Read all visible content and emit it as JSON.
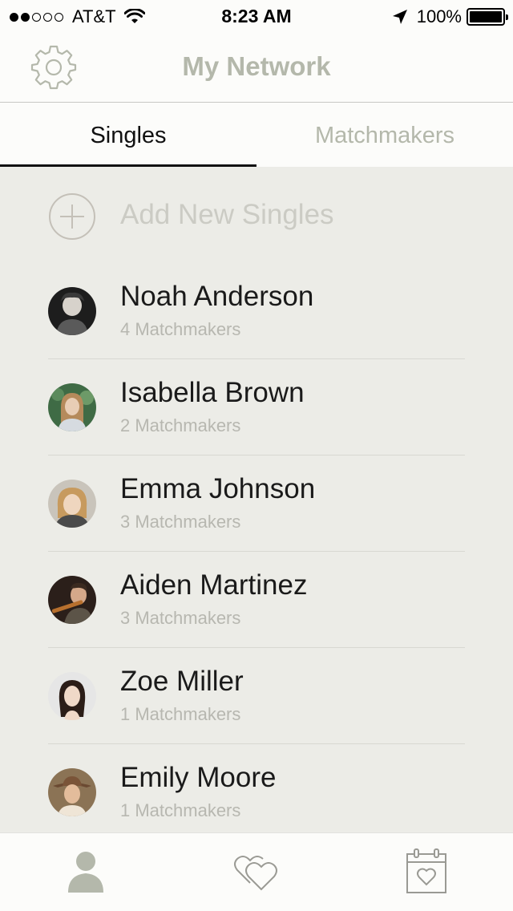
{
  "status_bar": {
    "carrier": "AT&T",
    "time": "8:23 AM",
    "battery": "100%",
    "signal_bars_filled": 2,
    "signal_bars_total": 5
  },
  "nav": {
    "title": "My Network",
    "settings_icon": "gear-icon"
  },
  "tabs": {
    "singles": "Singles",
    "matchmakers": "Matchmakers",
    "active": "singles"
  },
  "add_singles": {
    "label": "Add New Singles",
    "icon": "plus-circle-icon"
  },
  "people": [
    {
      "name": "Noah Anderson",
      "subtitle": "4 Matchmakers"
    },
    {
      "name": "Isabella Brown",
      "subtitle": "2 Matchmakers"
    },
    {
      "name": "Emma Johnson",
      "subtitle": "3 Matchmakers"
    },
    {
      "name": "Aiden Martinez",
      "subtitle": "3 Matchmakers"
    },
    {
      "name": "Zoe Miller",
      "subtitle": "1 Matchmakers"
    },
    {
      "name": "Emily Moore",
      "subtitle": "1 Matchmakers"
    }
  ],
  "tab_bar": {
    "items": [
      "person-icon",
      "hearts-icon",
      "calendar-heart-icon"
    ]
  },
  "colors": {
    "accent_muted": "#b4b8ab",
    "content_bg": "#ecece7",
    "text_primary": "#1a1a1a",
    "text_secondary": "#b7b7b0"
  }
}
